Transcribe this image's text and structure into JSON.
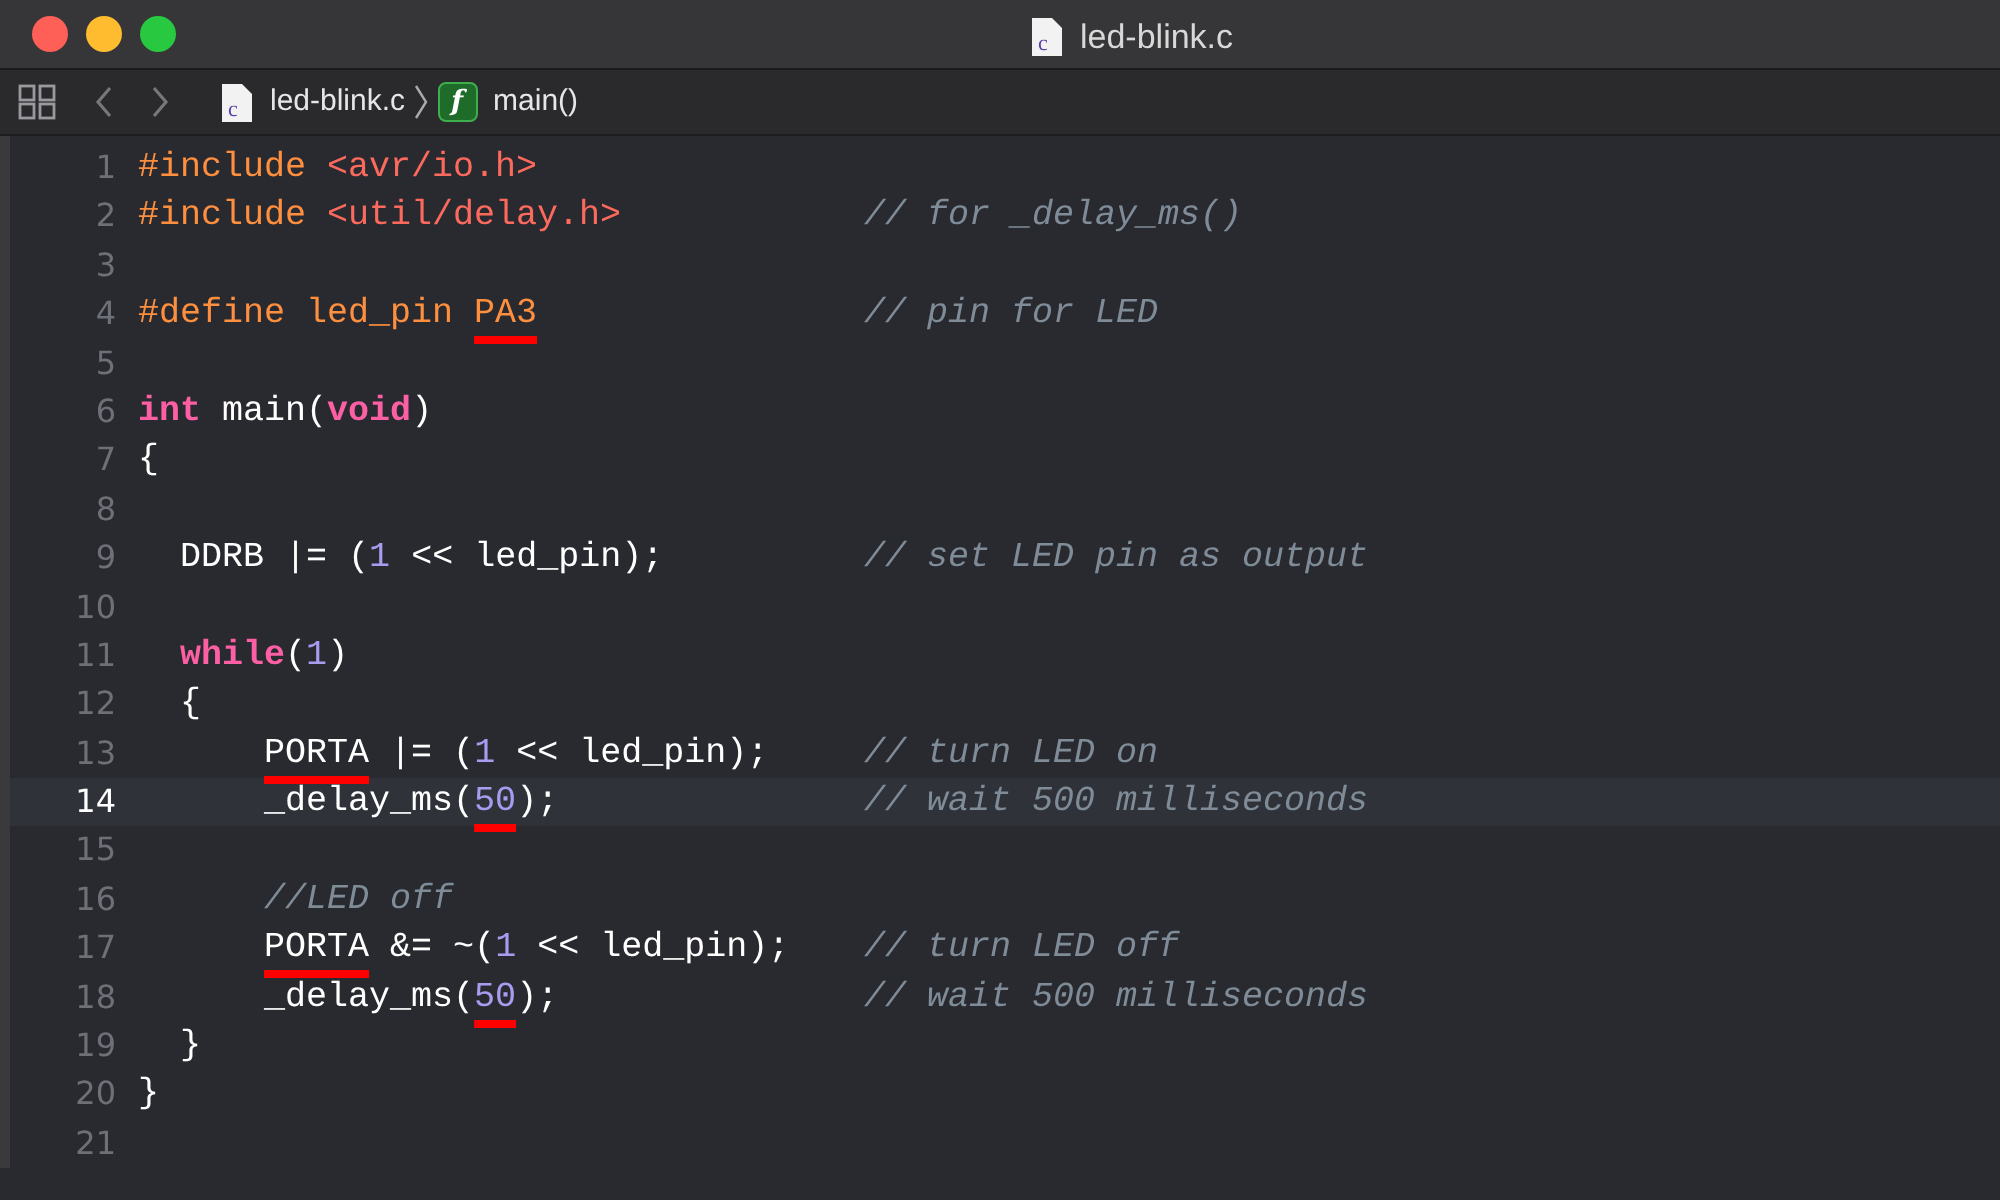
{
  "window": {
    "title": "led-blink.c",
    "title_icon": "c"
  },
  "jump_bar": {
    "file_icon": "c",
    "file": "led-blink.c",
    "symbol": "main()",
    "symbol_icon": "f"
  },
  "lines": [
    {
      "number": "1",
      "current": false,
      "tokens": [
        {
          "text": "#include",
          "kind": "preproc"
        },
        {
          "text": " <avr/io.h>",
          "kind": "string"
        }
      ]
    },
    {
      "number": "2",
      "current": false,
      "tokens": [
        {
          "text": "#include",
          "kind": "preproc"
        },
        {
          "text": " <util/delay.h>",
          "kind": "string"
        }
      ],
      "comment": "// for _delay_ms()"
    },
    {
      "number": "3",
      "current": false
    },
    {
      "number": "4",
      "current": false,
      "tokens": [
        {
          "text": "#define led_pin ",
          "kind": "preproc"
        },
        {
          "text": "PA3",
          "kind": "preproc",
          "underlined": true
        }
      ],
      "comment": "// pin for LED"
    },
    {
      "number": "5",
      "current": false
    },
    {
      "number": "6",
      "current": false,
      "tokens": [
        {
          "text": "int",
          "kind": "keyword"
        },
        {
          "text": " main(",
          "kind": "plain"
        },
        {
          "text": "void",
          "kind": "keyword"
        },
        {
          "text": ")",
          "kind": "plain"
        }
      ]
    },
    {
      "number": "7",
      "current": false,
      "tokens": [
        {
          "text": "{",
          "kind": "plain"
        }
      ]
    },
    {
      "number": "8",
      "current": false
    },
    {
      "number": "9",
      "current": false,
      "tokens": [
        {
          "text": "  DDRB |= (",
          "kind": "plain"
        },
        {
          "text": "1",
          "kind": "number"
        },
        {
          "text": " << led_pin);",
          "kind": "plain"
        }
      ],
      "comment": "// set LED pin as output"
    },
    {
      "number": "10",
      "current": false
    },
    {
      "number": "11",
      "current": false,
      "tokens": [
        {
          "text": "  while",
          "kind": "keyword"
        },
        {
          "text": "(",
          "kind": "plain"
        },
        {
          "text": "1",
          "kind": "number"
        },
        {
          "text": ")",
          "kind": "plain"
        }
      ]
    },
    {
      "number": "12",
      "current": false,
      "tokens": [
        {
          "text": "  {",
          "kind": "plain"
        }
      ]
    },
    {
      "number": "13",
      "current": false,
      "tokens": [
        {
          "text": "      PORTA",
          "kind": "plain",
          "underlined": true
        },
        {
          "text": " |= (",
          "kind": "plain"
        },
        {
          "text": "1",
          "kind": "number"
        },
        {
          "text": " << led_pin);",
          "kind": "plain"
        }
      ],
      "comment": "// turn LED on"
    },
    {
      "number": "14",
      "current": true,
      "tokens": [
        {
          "text": "      _delay_ms(",
          "kind": "plain"
        },
        {
          "text": "50",
          "kind": "number",
          "underlined": true
        },
        {
          "text": ");",
          "kind": "plain"
        }
      ],
      "comment": "// wait 500 milliseconds"
    },
    {
      "number": "15",
      "current": false
    },
    {
      "number": "16",
      "current": false,
      "tokens": [
        {
          "text": "      //LED off",
          "kind": "comment"
        }
      ]
    },
    {
      "number": "17",
      "current": false,
      "tokens": [
        {
          "text": "      PORTA",
          "kind": "plain",
          "underlined": true
        },
        {
          "text": " &= ~(",
          "kind": "plain"
        },
        {
          "text": "1",
          "kind": "number"
        },
        {
          "text": " << led_pin);",
          "kind": "plain"
        }
      ],
      "comment": "// turn LED off"
    },
    {
      "number": "18",
      "current": false,
      "tokens": [
        {
          "text": "      _delay_ms(",
          "kind": "plain"
        },
        {
          "text": "50",
          "kind": "number",
          "underlined": true
        },
        {
          "text": ");",
          "kind": "plain"
        }
      ],
      "comment": "// wait 500 milliseconds"
    },
    {
      "number": "19",
      "current": false,
      "tokens": [
        {
          "text": "  }",
          "kind": "plain"
        }
      ]
    },
    {
      "number": "20",
      "current": false,
      "tokens": [
        {
          "text": "}",
          "kind": "plain"
        }
      ]
    },
    {
      "number": "21",
      "current": false
    }
  ]
}
